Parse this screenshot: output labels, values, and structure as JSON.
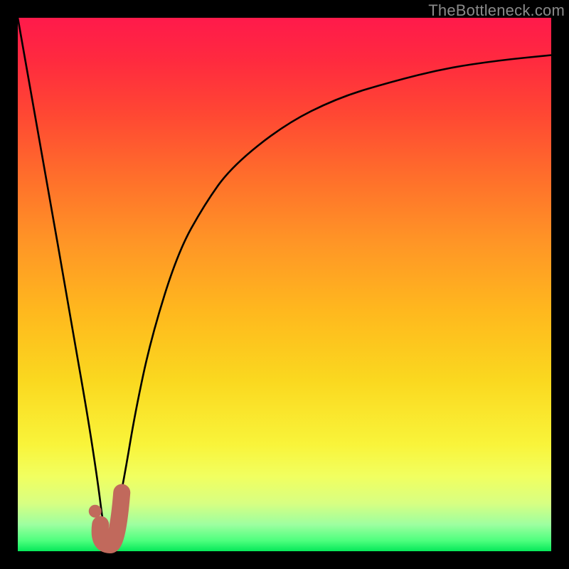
{
  "watermark": {
    "text": "TheBottleneck.com"
  },
  "chart_data": {
    "type": "line",
    "title": "",
    "xlabel": "",
    "ylabel": "",
    "xlim": [
      0,
      100
    ],
    "ylim": [
      0,
      100
    ],
    "series": [
      {
        "name": "bottleneck-curve",
        "x": [
          0,
          5,
          10,
          13,
          15,
          16,
          17,
          18,
          20,
          22,
          25,
          30,
          35,
          40,
          50,
          60,
          70,
          80,
          90,
          100
        ],
        "y": [
          100,
          72,
          43,
          26,
          13,
          5,
          0,
          4,
          14,
          26,
          40,
          56,
          65,
          72,
          80,
          85,
          88,
          90.5,
          92,
          93
        ]
      }
    ],
    "markers": [
      {
        "name": "marker-dot",
        "x": 14.5,
        "y": 7.5,
        "r": 1.2,
        "color": "#c1695c"
      },
      {
        "name": "marker-hook",
        "shape": "J",
        "x0": 15.5,
        "y0": 3,
        "x1": 19.5,
        "y1": 11,
        "stroke_width": 3.2,
        "color": "#c1695c"
      }
    ],
    "colors": {
      "curve": "#000000",
      "marker": "#c1695c",
      "gradient_top": "#ff1a4b",
      "gradient_bottom": "#06e859"
    }
  }
}
